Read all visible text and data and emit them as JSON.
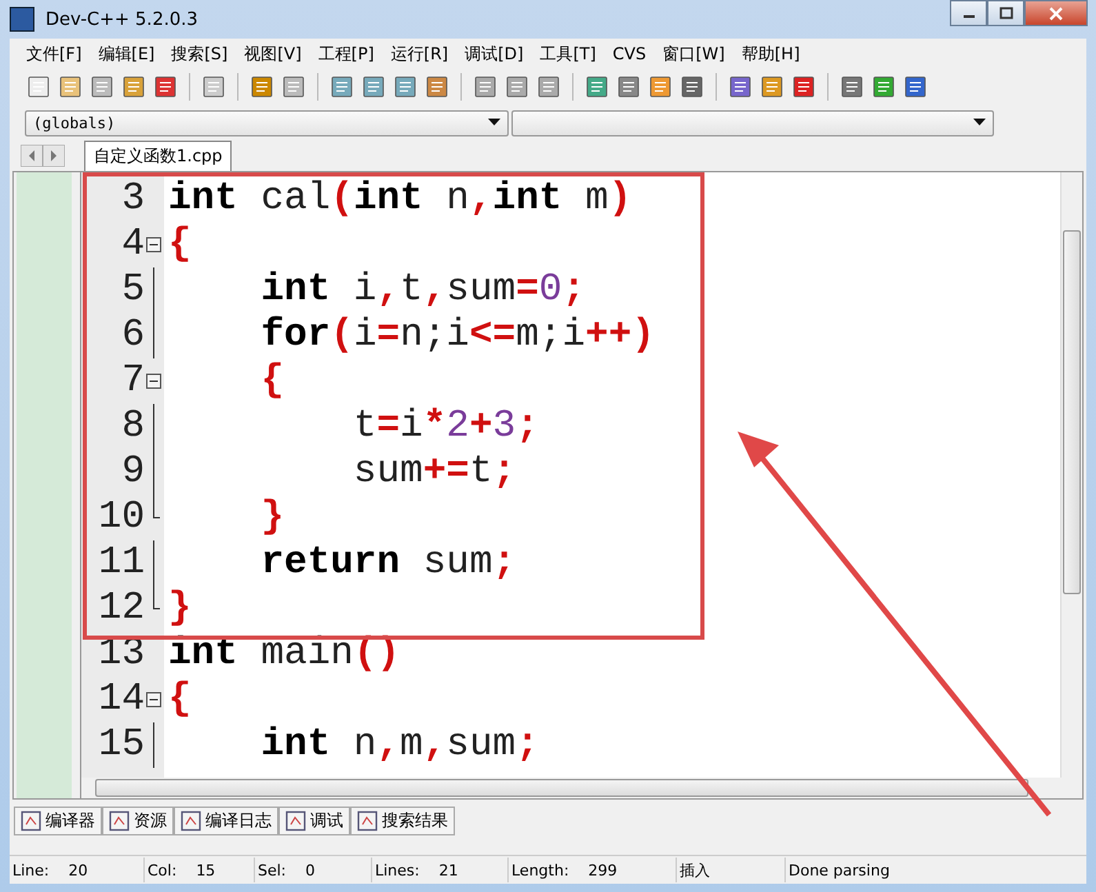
{
  "window": {
    "title": "Dev-C++ 5.2.0.3"
  },
  "menu": [
    "文件[F]",
    "编辑[E]",
    "搜索[S]",
    "视图[V]",
    "工程[P]",
    "运行[R]",
    "调试[D]",
    "工具[T]",
    "CVS",
    "窗口[W]",
    "帮助[H]"
  ],
  "scope_combo": {
    "value": "(globals)"
  },
  "file_tabs": [
    {
      "label": "自定义函数1.cpp",
      "selected": true
    }
  ],
  "editor": {
    "lines": [
      {
        "num": "3",
        "kind": "plain",
        "tokens": [
          {
            "kind": "kw",
            "t": "int"
          },
          {
            "kind": "id",
            "t": " cal"
          },
          {
            "kind": "op",
            "t": "("
          },
          {
            "kind": "kw",
            "t": "int"
          },
          {
            "kind": "id",
            "t": " n"
          },
          {
            "kind": "op",
            "t": ","
          },
          {
            "kind": "kw",
            "t": "int"
          },
          {
            "kind": "id",
            "t": " m"
          },
          {
            "kind": "op",
            "t": ")"
          }
        ]
      },
      {
        "num": "4",
        "kind": "fold-start",
        "tokens": [
          {
            "kind": "op",
            "t": "{"
          }
        ]
      },
      {
        "num": "5",
        "kind": "fold-body",
        "tokens": [
          {
            "kind": "kw",
            "t": "    int"
          },
          {
            "kind": "id",
            "t": " i"
          },
          {
            "kind": "op",
            "t": ","
          },
          {
            "kind": "id",
            "t": "t"
          },
          {
            "kind": "op",
            "t": ","
          },
          {
            "kind": "id",
            "t": "sum"
          },
          {
            "kind": "op",
            "t": "="
          },
          {
            "kind": "num",
            "t": "0"
          },
          {
            "kind": "op",
            "t": ";"
          }
        ]
      },
      {
        "num": "6",
        "kind": "fold-body",
        "tokens": [
          {
            "kind": "kw",
            "t": "    for"
          },
          {
            "kind": "op",
            "t": "("
          },
          {
            "kind": "id",
            "t": "i"
          },
          {
            "kind": "op",
            "t": "="
          },
          {
            "kind": "id",
            "t": "n;i"
          },
          {
            "kind": "op",
            "t": "<="
          },
          {
            "kind": "id",
            "t": "m;i"
          },
          {
            "kind": "op",
            "t": "++)"
          }
        ]
      },
      {
        "num": "7",
        "kind": "fold-start",
        "tokens": [
          {
            "kind": "op",
            "t": "    {"
          }
        ]
      },
      {
        "num": "8",
        "kind": "fold-body",
        "tokens": [
          {
            "kind": "id",
            "t": "        t"
          },
          {
            "kind": "op",
            "t": "="
          },
          {
            "kind": "id",
            "t": "i"
          },
          {
            "kind": "op",
            "t": "*"
          },
          {
            "kind": "num",
            "t": "2"
          },
          {
            "kind": "op",
            "t": "+"
          },
          {
            "kind": "num",
            "t": "3"
          },
          {
            "kind": "op",
            "t": ";"
          }
        ]
      },
      {
        "num": "9",
        "kind": "fold-body",
        "tokens": [
          {
            "kind": "id",
            "t": "        sum"
          },
          {
            "kind": "op",
            "t": "+="
          },
          {
            "kind": "id",
            "t": "t"
          },
          {
            "kind": "op",
            "t": ";"
          }
        ]
      },
      {
        "num": "10",
        "kind": "fold-end",
        "tokens": [
          {
            "kind": "op",
            "t": "    }"
          }
        ]
      },
      {
        "num": "11",
        "kind": "fold-body",
        "tokens": [
          {
            "kind": "kw",
            "t": "    return"
          },
          {
            "kind": "id",
            "t": " sum"
          },
          {
            "kind": "op",
            "t": ";"
          }
        ]
      },
      {
        "num": "12",
        "kind": "fold-end",
        "tokens": [
          {
            "kind": "op",
            "t": "}"
          }
        ]
      },
      {
        "num": "13",
        "kind": "plain",
        "tokens": [
          {
            "kind": "kw",
            "t": "int"
          },
          {
            "kind": "id",
            "t": " main"
          },
          {
            "kind": "op",
            "t": "()"
          }
        ]
      },
      {
        "num": "14",
        "kind": "fold-start",
        "tokens": [
          {
            "kind": "op",
            "t": "{"
          }
        ]
      },
      {
        "num": "15",
        "kind": "fold-body",
        "tokens": [
          {
            "kind": "kw",
            "t": "    int"
          },
          {
            "kind": "id",
            "t": " n"
          },
          {
            "kind": "op",
            "t": ","
          },
          {
            "kind": "id",
            "t": "m"
          },
          {
            "kind": "op",
            "t": ","
          },
          {
            "kind": "id",
            "t": "sum"
          },
          {
            "kind": "op",
            "t": ";"
          }
        ]
      }
    ]
  },
  "bottom_tabs": [
    {
      "label": "编译器"
    },
    {
      "label": "资源"
    },
    {
      "label": "编译日志"
    },
    {
      "label": "调试"
    },
    {
      "label": "搜索结果"
    }
  ],
  "status_bar": [
    {
      "label": "Line:",
      "value": "20"
    },
    {
      "label": "Col:",
      "value": "15"
    },
    {
      "label": "Sel:",
      "value": "0"
    },
    {
      "label": "Lines:",
      "value": "21"
    },
    {
      "label": "Length:",
      "value": "299"
    },
    {
      "value": "插入"
    },
    {
      "value": "Done parsing"
    }
  ]
}
